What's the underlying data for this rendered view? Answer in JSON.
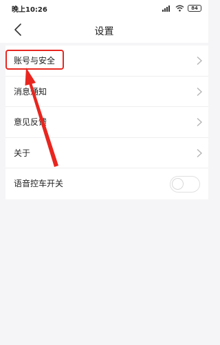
{
  "status_bar": {
    "time": "晚上10:26",
    "battery": "84"
  },
  "header": {
    "title": "设置",
    "back_icon": "back-chevron-icon"
  },
  "settings": {
    "items": [
      {
        "label": "账号与安全",
        "icon": "chevron-right-icon"
      },
      {
        "label": "消息通知",
        "icon": "chevron-right-icon"
      },
      {
        "label": "意见反馈",
        "icon": "chevron-right-icon"
      },
      {
        "label": "关于",
        "icon": "chevron-right-icon"
      }
    ],
    "voice_toggle": {
      "label": "语音控车开关",
      "on": false
    }
  },
  "annotation": {
    "color": "#e8261f"
  }
}
